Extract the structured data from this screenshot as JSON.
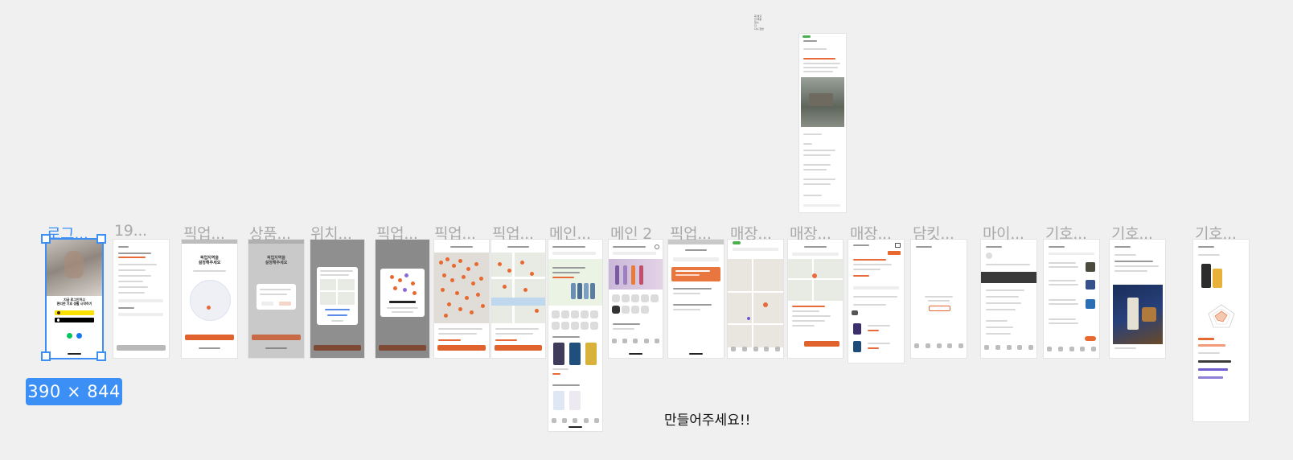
{
  "canvas": {
    "background": "#f0f0f0",
    "selection_color": "#3b8ff5",
    "brand_orange": "#e0632e"
  },
  "frames": [
    {
      "label": "로그...",
      "selected": true
    },
    {
      "label": "19..."
    },
    {
      "label": "픽업..."
    },
    {
      "label": "상품..."
    },
    {
      "label": "위치..."
    },
    {
      "label": "픽업..."
    },
    {
      "label": "픽업..."
    },
    {
      "label": "픽업..."
    },
    {
      "label": "메인..."
    },
    {
      "label": "메인 2"
    },
    {
      "label": "픽업..."
    },
    {
      "label": "매장..."
    },
    {
      "label": "매장..."
    },
    {
      "label": "매장..."
    },
    {
      "label": "담킷..."
    },
    {
      "label": "마이..."
    },
    {
      "label": "기호..."
    },
    {
      "label": "기호..."
    },
    {
      "label": "기호..."
    }
  ],
  "selection": {
    "size_label": "390 × 844"
  },
  "comment": {
    "text": "만들어주세요!!"
  },
  "screens": {
    "login": {
      "headline": "지금 로그인하고\n편리한 기호 생활 시작하기"
    },
    "pickup_region": {
      "headline": "픽업지역을\n설정해주세요"
    },
    "product_region": {
      "headline": "픽업지역을\n설정해주세요"
    }
  },
  "icons": [
    "kakao-icon",
    "apple-icon",
    "naver-icon",
    "facebook-icon",
    "map-pin-icon",
    "search-icon",
    "cart-icon"
  ]
}
